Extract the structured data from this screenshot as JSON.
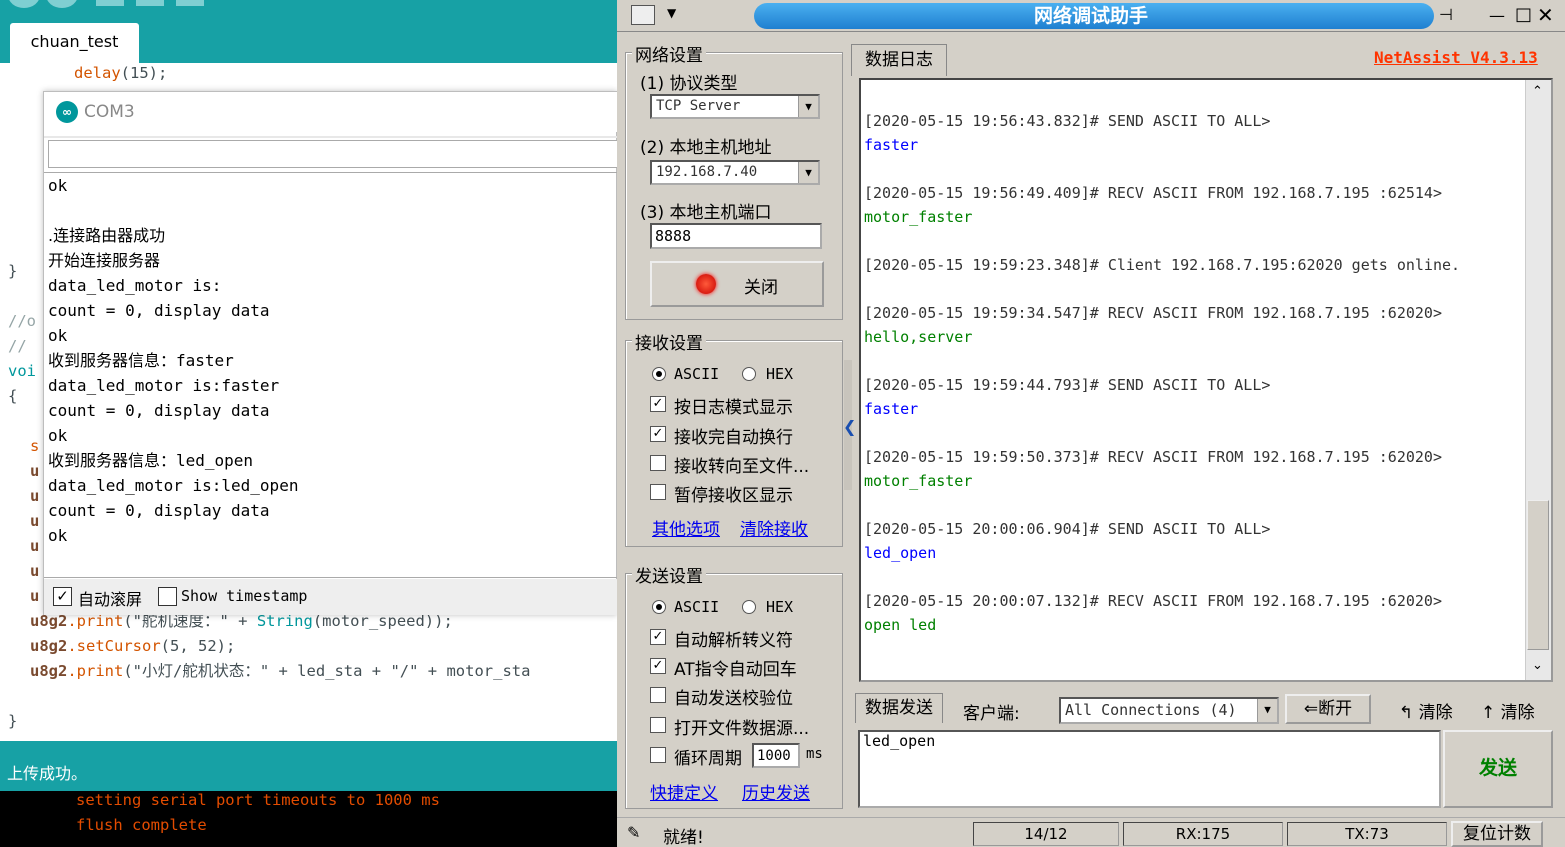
{
  "ide": {
    "tab_label": "chuan_test",
    "code_lines": [
      {
        "text": "delay",
        "suffix": "(15);"
      },
      {
        "text": "}"
      },
      {
        "text": "//o"
      },
      {
        "text": "// "
      },
      {
        "text": "voi"
      },
      {
        "text": "{"
      },
      {
        "text": "s"
      },
      {
        "text": "u"
      },
      {
        "text": "u"
      },
      {
        "text": "u"
      },
      {
        "text": "u"
      },
      {
        "text": "u"
      },
      {
        "text": "u"
      }
    ],
    "code_print1": {
      "obj": "u8g2",
      "fn": ".print",
      "pre": "(\"舵机速度：\" + ",
      "type": "String",
      "post": "(motor_speed));"
    },
    "code_cursor": {
      "obj": "u8g2",
      "fn": ".setCursor",
      "post": "(5, 52);"
    },
    "code_print2": {
      "obj": "u8g2",
      "fn": ".print",
      "post": "(\"小灯/舵机状态：\" + led_sta + \"/\" + motor_sta"
    },
    "code_close": "}",
    "status_text": "上传成功。",
    "console_lines": [
      "setting serial port timeouts to 1000 ms",
      "flush complete"
    ]
  },
  "serial_monitor": {
    "title": "COM3",
    "logo_text": "∞",
    "input_value": "",
    "output_lines": [
      "ok",
      "",
      ".连接路由器成功",
      "开始连接服务器",
      "data_led_motor is:",
      "count = 0, display data",
      "ok",
      "收到服务器信息：faster",
      "data_led_motor is:faster",
      "count = 0, display data",
      "ok",
      "收到服务器信息：led_open",
      "data_led_motor is:led_open",
      "count = 0, display data",
      "ok"
    ],
    "autoscroll_label": "自动滚屏",
    "autoscroll_checked": true,
    "timestamp_label": "Show timestamp",
    "timestamp_checked": false
  },
  "netassist": {
    "title": "网络调试助手",
    "brand": "NetAssist V4.3.13",
    "brand_color": "#ff3300",
    "net_settings": {
      "group_label": "网络设置",
      "protocol_label": "(1) 协议类型",
      "protocol_value": "TCP Server",
      "host_label": "(2) 本地主机地址",
      "host_value": "192.168.7.40",
      "port_label": "(3) 本地主机端口",
      "port_value": "8888",
      "close_button": "关闭"
    },
    "recv_settings": {
      "group_label": "接收设置",
      "ascii": "ASCII",
      "hex": "HEX",
      "mode": "ASCII",
      "options": [
        {
          "label": "按日志模式显示",
          "checked": true
        },
        {
          "label": "接收完自动换行",
          "checked": true
        },
        {
          "label": "接收转向至文件...",
          "checked": false
        },
        {
          "label": "暂停接收区显示",
          "checked": false
        }
      ],
      "link_more": "其他选项",
      "link_clear": "清除接收"
    },
    "send_settings": {
      "group_label": "发送设置",
      "ascii": "ASCII",
      "hex": "HEX",
      "mode": "ASCII",
      "options": [
        {
          "label": "自动解析转义符",
          "checked": true
        },
        {
          "label": "AT指令自动回车",
          "checked": true
        },
        {
          "label": "自动发送校验位",
          "checked": false
        },
        {
          "label": "打开文件数据源...",
          "checked": false
        }
      ],
      "cycle_label": "循环周期",
      "cycle_value": "1000",
      "cycle_unit": "ms",
      "cycle_checked": false,
      "link_shortcut": "快捷定义",
      "link_history": "历史发送"
    },
    "log_tab": "数据日志",
    "log_entries": [
      {
        "header": "[2020-05-15 19:56:43.832]# SEND ASCII TO ALL>",
        "body": "faster",
        "kind": "send"
      },
      {
        "header": "[2020-05-15 19:56:49.409]# RECV ASCII FROM 192.168.7.195 :62514>",
        "body": "motor_faster",
        "kind": "recv"
      },
      {
        "header": "[2020-05-15 19:59:23.348]# Client 192.168.7.195:62020 gets online.",
        "body": "",
        "kind": "info"
      },
      {
        "header": "[2020-05-15 19:59:34.547]# RECV ASCII FROM 192.168.7.195 :62020>",
        "body": "hello,server",
        "kind": "recv"
      },
      {
        "header": "[2020-05-15 19:59:44.793]# SEND ASCII TO ALL>",
        "body": "faster",
        "kind": "send"
      },
      {
        "header": "[2020-05-15 19:59:50.373]# RECV ASCII FROM 192.168.7.195 :62020>",
        "body": "motor_faster",
        "kind": "recv"
      },
      {
        "header": "[2020-05-15 20:00:06.904]# SEND ASCII TO ALL>",
        "body": "led_open",
        "kind": "send"
      },
      {
        "header": "[2020-05-15 20:00:07.132]# RECV ASCII FROM 192.168.7.195 :62020>",
        "body": "open led",
        "kind": "recv"
      }
    ],
    "send_tab": "数据发送",
    "client_label": "客户端:",
    "client_value": "All Connections (4)",
    "disconnect_button": "断开",
    "clear1_button": "清除",
    "clear2_button": "清除",
    "send_text": "led_open",
    "send_button": "发送",
    "status_ready": "就绪!",
    "status_count": "14/12",
    "status_rx": "RX:175",
    "status_tx": "TX:73",
    "reset_button": "复位计数"
  }
}
